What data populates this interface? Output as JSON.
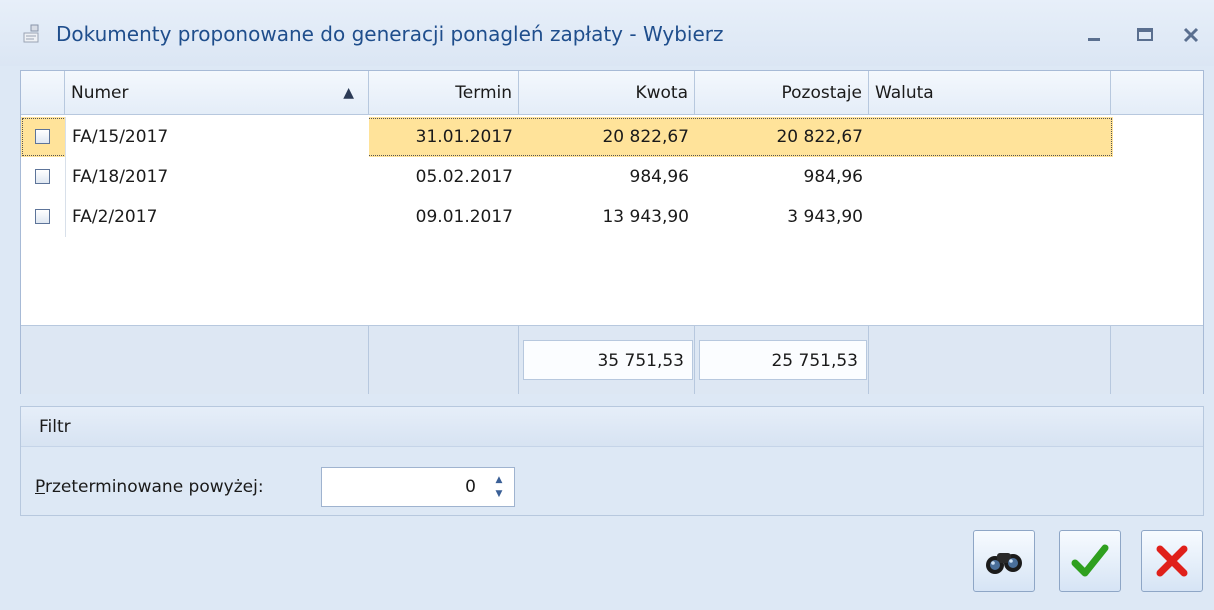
{
  "window": {
    "title": "Dokumenty proponowane do generacji ponagleń zapłaty - Wybierz",
    "controls": [
      "minimize",
      "maximize",
      "close"
    ]
  },
  "grid": {
    "columns": [
      "Numer",
      "Termin",
      "Kwota",
      "Pozostaje",
      "Waluta"
    ],
    "sort_indicator": "▲",
    "rows": [
      {
        "checked": false,
        "numer": "FA/15/2017",
        "termin": "31.01.2017",
        "kwota": "20 822,67",
        "pozostaje": "20 822,67",
        "waluta": "",
        "selected": true
      },
      {
        "checked": false,
        "numer": "FA/18/2017",
        "termin": "05.02.2017",
        "kwota": "984,96",
        "pozostaje": "984,96",
        "waluta": ""
      },
      {
        "checked": false,
        "numer": "FA/2/2017",
        "termin": "09.01.2017",
        "kwota": "13 943,90",
        "pozostaje": "3 943,90",
        "waluta": ""
      }
    ],
    "totals": {
      "kwota": "35 751,53",
      "pozostaje": "25 751,53"
    }
  },
  "filter": {
    "title": "Filtr",
    "label": "Przeterminowane powyżej:",
    "value": "0"
  },
  "buttons": [
    "binoculars-icon",
    "checkmark-icon",
    "cross-icon"
  ],
  "colors": {
    "selected_row": "#ffe39a",
    "title_text": "#1f4e8c",
    "ok_green": "#2fa01f",
    "cancel_red": "#e0201a"
  }
}
